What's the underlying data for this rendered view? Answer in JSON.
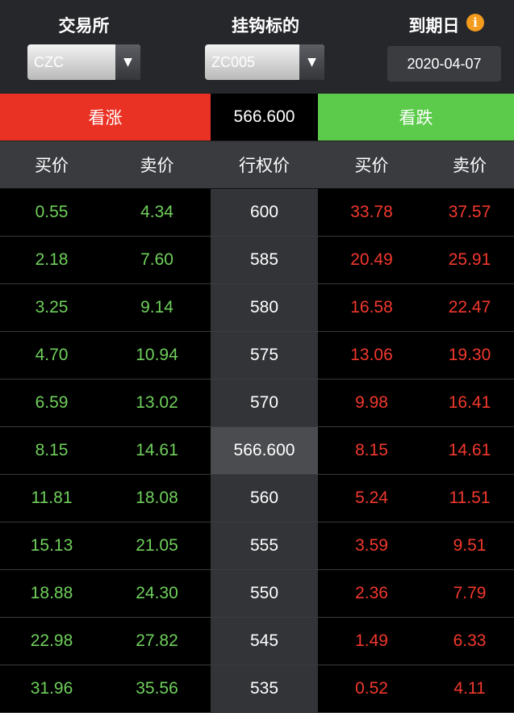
{
  "header": {
    "exchange_label": "交易所",
    "exchange_value": "CZC",
    "underlying_label": "挂钩标的",
    "underlying_value": "ZC005",
    "expiry_label": "到期日",
    "expiry_value": "2020-04-07",
    "info_icon": "i"
  },
  "actions": {
    "call_label": "看涨",
    "underlying_price": "566.600",
    "put_label": "看跌"
  },
  "columns": [
    "买价",
    "卖价",
    "行权价",
    "买价",
    "卖价"
  ],
  "rows": [
    {
      "call_bid": "0.55",
      "call_ask": "4.34",
      "strike": "600",
      "put_bid": "33.78",
      "put_ask": "37.57"
    },
    {
      "call_bid": "2.18",
      "call_ask": "7.60",
      "strike": "585",
      "put_bid": "20.49",
      "put_ask": "25.91"
    },
    {
      "call_bid": "3.25",
      "call_ask": "9.14",
      "strike": "580",
      "put_bid": "16.58",
      "put_ask": "22.47"
    },
    {
      "call_bid": "4.70",
      "call_ask": "10.94",
      "strike": "575",
      "put_bid": "13.06",
      "put_ask": "19.30"
    },
    {
      "call_bid": "6.59",
      "call_ask": "13.02",
      "strike": "570",
      "put_bid": "9.98",
      "put_ask": "16.41"
    },
    {
      "call_bid": "8.15",
      "call_ask": "14.61",
      "strike": "566.600",
      "put_bid": "8.15",
      "put_ask": "14.61",
      "atm": true
    },
    {
      "call_bid": "11.81",
      "call_ask": "18.08",
      "strike": "560",
      "put_bid": "5.24",
      "put_ask": "11.51"
    },
    {
      "call_bid": "15.13",
      "call_ask": "21.05",
      "strike": "555",
      "put_bid": "3.59",
      "put_ask": "9.51"
    },
    {
      "call_bid": "18.88",
      "call_ask": "24.30",
      "strike": "550",
      "put_bid": "2.36",
      "put_ask": "7.79"
    },
    {
      "call_bid": "22.98",
      "call_ask": "27.82",
      "strike": "545",
      "put_bid": "1.49",
      "put_ask": "6.33"
    },
    {
      "call_bid": "31.96",
      "call_ask": "35.56",
      "strike": "535",
      "put_bid": "0.52",
      "put_ask": "4.11"
    }
  ],
  "colors": {
    "call_green": "#6fd05b",
    "put_red": "#f2382d",
    "call_button": "#ea3224",
    "put_button": "#5ccb4b",
    "info_orange": "#f39b1c"
  }
}
